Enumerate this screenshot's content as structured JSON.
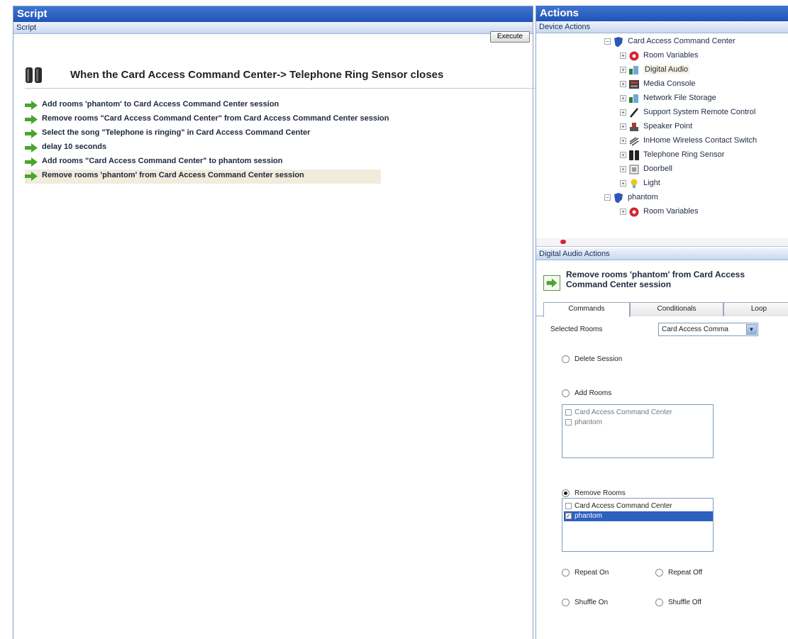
{
  "script_panel": {
    "title": "Script",
    "sub_title": "Script",
    "execute_label": "Execute",
    "trigger": "When the Card Access Command Center-> Telephone Ring Sensor closes",
    "steps": [
      "Add rooms 'phantom' to Card Access Command Center session",
      "Remove rooms \"Card Access Command Center\" from Card Access Command Center session",
      "Select the song \"Telephone is ringing\" in Card Access Command Center",
      "delay 10 seconds",
      "Add rooms \"Card Access Command Center\" to phantom session",
      "Remove rooms 'phantom' from Card Access Command Center session"
    ]
  },
  "actions_panel": {
    "title": "Actions",
    "device_actions_label": "Device Actions",
    "tree": {
      "root": "Card Access Command Center",
      "children": [
        "Room Variables",
        "Digital Audio",
        "Media Console",
        "Network File Storage",
        "Support System Remote Control",
        "Speaker Point",
        "InHome Wireless Contact Switch",
        "Telephone Ring Sensor",
        "Doorbell",
        "Light"
      ],
      "second_root": "phantom",
      "second_children": [
        "Room Variables"
      ]
    },
    "digital_audio_actions_label": "Digital Audio Actions",
    "selected_action": "Remove rooms 'phantom' from Card Access Command Center session",
    "tabs": [
      "Commands",
      "Conditionals",
      "Loop"
    ],
    "selected_rooms_label": "Selected Rooms",
    "selected_rooms_value": "Card Access Comma",
    "delete_session_label": "Delete Session",
    "add_rooms_label": "Add Rooms",
    "add_rooms_list": [
      "Card Access Command Center",
      "phantom"
    ],
    "remove_rooms_label": "Remove Rooms",
    "remove_rooms_list": [
      "Card Access Command Center",
      "phantom"
    ],
    "repeat_on_label": "Repeat On",
    "repeat_off_label": "Repeat Off",
    "shuffle_on_label": "Shuffle On",
    "shuffle_off_label": "Shuffle Off"
  },
  "colors": {
    "title_bar": "#2f64c4",
    "selection": "#2c5fbf",
    "action_arrow": "#4aa52e"
  }
}
